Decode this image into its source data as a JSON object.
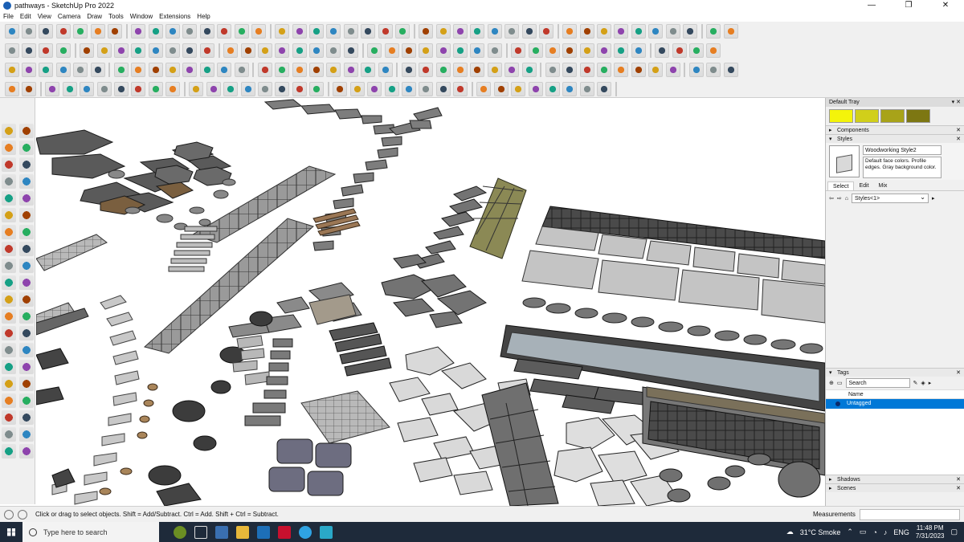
{
  "window": {
    "title": "pathways - SketchUp Pro 2022",
    "min": "—",
    "max": "❐",
    "close": "✕"
  },
  "menu": [
    "File",
    "Edit",
    "View",
    "Camera",
    "Draw",
    "Tools",
    "Window",
    "Extensions",
    "Help"
  ],
  "tray": {
    "title": "Default Tray",
    "pin": "▾ ✕",
    "swatch_colors": [
      "#f4f40a",
      "#d1cf1a",
      "#a8a319",
      "#7d7712"
    ],
    "components_label": "Components",
    "styles_label": "Styles",
    "style_name": "Woodworking Style2",
    "style_description": "Default face colors. Profile edges. Gray background color.",
    "tabs": [
      "Select",
      "Edit",
      "Mix"
    ],
    "style_dropdown": "Styles<1>",
    "tags_label": "Tags",
    "tags_search_placeholder": "Search",
    "tags_column": "Name",
    "tags": [
      "Untagged"
    ],
    "shadows_label": "Shadows",
    "scenes_label": "Scenes"
  },
  "status": {
    "message": "Click or drag to select objects. Shift = Add/Subtract. Ctrl = Add. Shift + Ctrl = Subtract.",
    "measurements_label": "Measurements"
  },
  "taskbar": {
    "search_placeholder": "Type here to search",
    "weather": "31°C  Smoke",
    "language": "ENG",
    "time": "11:48 PM",
    "date": "7/31/2023"
  }
}
